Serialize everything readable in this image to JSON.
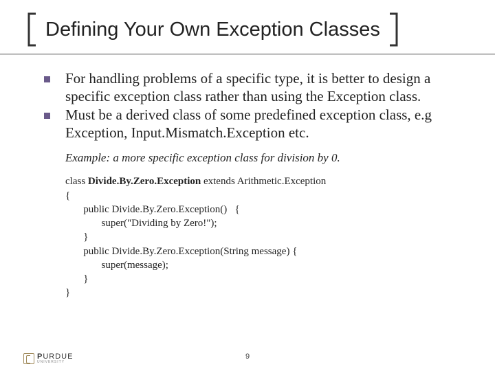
{
  "title": "Defining Your Own Exception Classes",
  "bullets": [
    "For handling problems of a specific type, it is better to design a specific exception class rather than using the Exception class.",
    "Must be a derived class of some predefined exception class, e.g Exception, Input.Mismatch.Exception etc."
  ],
  "example_label": "Example: a more specific exception class for division by 0.",
  "code": {
    "line1_pre": "class ",
    "line1_mid": "Divide.By.Zero.Exception",
    "line1_post": " extends Arithmetic.Exception",
    "line2": "{",
    "line3": "       public Divide.By.Zero.Exception()   {",
    "line4": "              super(\"Dividing by Zero!\");",
    "line5": "       }",
    "line6": "       public Divide.By.Zero.Exception(String message) {",
    "line7": "              super(message);",
    "line8": "       }",
    "line9": "}"
  },
  "page_number": "9",
  "logo": {
    "main_bold": "P",
    "main_rest": "URDUE",
    "sub": "UNIVERSITY"
  }
}
